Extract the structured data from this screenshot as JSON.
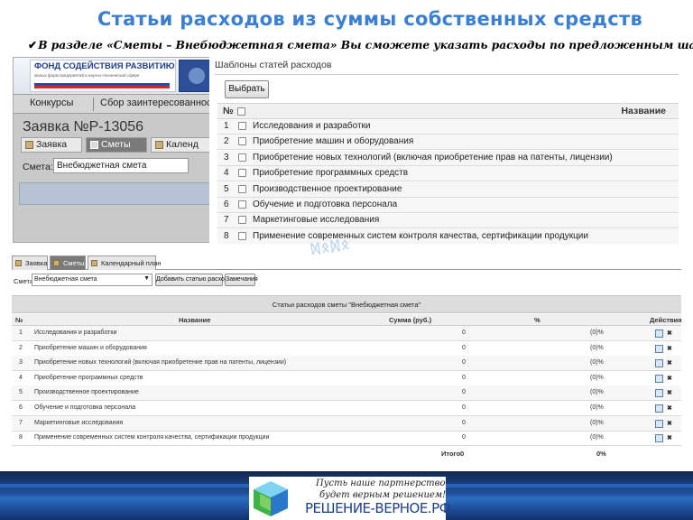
{
  "slide": {
    "title": "Статьи расходов из суммы собственных средств",
    "subtitle_check": "✔",
    "subtitle": "В разделе «Сметы – Внебюджетная смета» Вы сможете указать расходы по предложенным шаблонам"
  },
  "app": {
    "logo_title": "ФОНД СОДЕЙСТВИЯ РАЗВИТИЮ",
    "logo_subtitle": "малых форм предприятий в научно-технической сфере",
    "menu": [
      "Конкурсы",
      "Сбор заинтересованност"
    ],
    "order_title": "Заявка №Р-13056",
    "tabs": [
      "Заявка",
      "Сметы",
      "Календ"
    ],
    "smeta_label": "Смета:",
    "smeta_value": "Внебюджетная смета"
  },
  "templates_popup": {
    "title": "Шаблоны статей расходов",
    "choose_button": "Выбрать",
    "col_num": "№",
    "col_name": "Название",
    "rows": [
      {
        "n": "1",
        "name": "Исследования и разработки"
      },
      {
        "n": "2",
        "name": "Приобретение машин и оборудования"
      },
      {
        "n": "3",
        "name": "Приобретение новых технологий (включая приобретение прав на патенты, лицензии)"
      },
      {
        "n": "4",
        "name": "Приобретение программных средств"
      },
      {
        "n": "5",
        "name": "Производственное проектирование"
      },
      {
        "n": "6",
        "name": "Обучение и подготовка персонала"
      },
      {
        "n": "7",
        "name": "Маркетинговые исследования"
      },
      {
        "n": "8",
        "name": "Применение современных систем контроля качества, сертификации продукции"
      }
    ]
  },
  "lower": {
    "tabs": [
      "Заявка",
      "Сметы",
      "Календарный план"
    ],
    "smeta_label": "Смета:",
    "smeta_value": "Внебюджетная смета",
    "dropdown_arrow": "▼",
    "add_button": "Добавить статью расходов",
    "comments_button": "Замечания",
    "table_title": "Статьи расходов сметы \"Внебюджетная смета\"",
    "headers": {
      "num": "№",
      "name": "Название",
      "sum": "Сумма (руб.)",
      "pct": "%",
      "actions": "Действия"
    },
    "rows": [
      {
        "n": "1",
        "name": "Исследования и разработки",
        "sum": "0",
        "pct": "(0)%"
      },
      {
        "n": "2",
        "name": "Приобретение машин и оборудования",
        "sum": "0",
        "pct": "(0)%"
      },
      {
        "n": "3",
        "name": "Приобретение новых технологий (включая приобретение прав на патенты, лицензии)",
        "sum": "0",
        "pct": "(0)%"
      },
      {
        "n": "4",
        "name": "Приобретение программных средств",
        "sum": "0",
        "pct": "(0)%"
      },
      {
        "n": "5",
        "name": "Производственное проектирование",
        "sum": "0",
        "pct": "(0)%"
      },
      {
        "n": "6",
        "name": "Обучение и подготовка персонала",
        "sum": "0",
        "pct": "(0)%"
      },
      {
        "n": "7",
        "name": "Маркетинговые исследования",
        "sum": "0",
        "pct": "(0)%"
      },
      {
        "n": "8",
        "name": "Применение современных систем контроля качества, сертификации продукции",
        "sum": "0",
        "pct": "(0)%"
      }
    ],
    "total_label": "Итого",
    "total_sum": "0",
    "total_pct": "0%",
    "delete_glyph": "✖"
  },
  "footer": {
    "slogan_line1": "Пусть наше партнерство",
    "slogan_line2": "будет верным решением!",
    "brand": "РЕШЕНИЕ-ВЕРНОЕ.РФ"
  },
  "colors": {
    "title_blue": "#3a7fd4",
    "footer_navy": "#12306a",
    "brand_blue": "#1e3f88",
    "delete_red": "#c92a2a"
  }
}
